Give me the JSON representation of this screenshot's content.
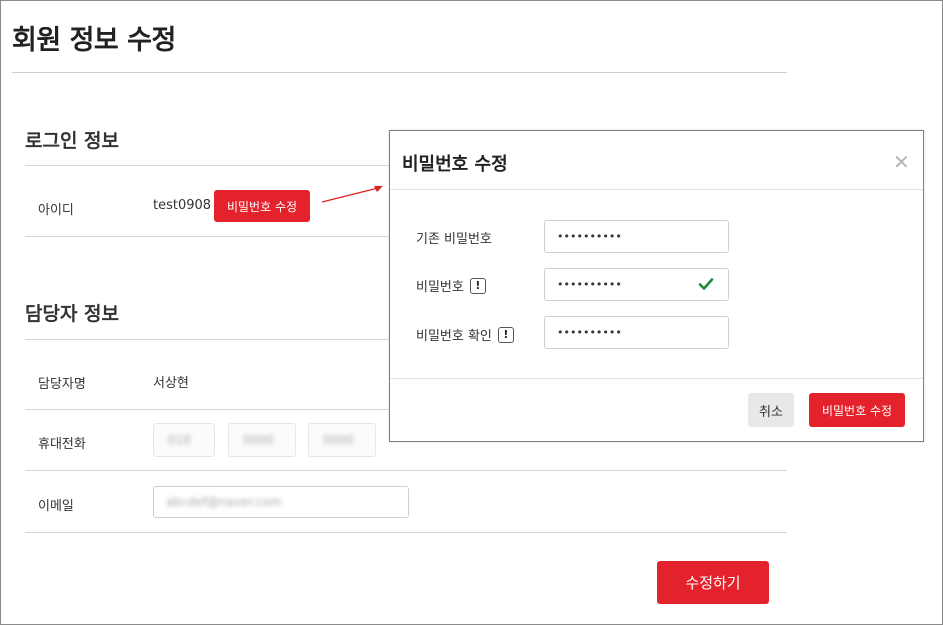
{
  "page": {
    "title": "회원 정보 수정"
  },
  "login_section": {
    "title": "로그인 정보",
    "id_label": "아이디",
    "id_value": "test0908",
    "change_password_button": "비밀번호 수정"
  },
  "manager_section": {
    "title": "담당자 정보",
    "name_label": "담당자명",
    "name_value": "서상현",
    "phone_label": "휴대전화",
    "phone_parts": [
      "010",
      "0000",
      "0000"
    ],
    "email_label": "이메일",
    "email_value": "abcdef@naver.com"
  },
  "submit_button": "수정하기",
  "modal": {
    "title": "비밀번호 수정",
    "close_glyph": "✕",
    "current_password_label": "기존 비밀번호",
    "current_password_value": "••••••••••",
    "new_password_label": "비밀번호",
    "new_password_value": "••••••••••",
    "confirm_password_label": "비밀번호 확인",
    "confirm_password_value": "••••••••••",
    "warn_glyph": "!",
    "cancel_button": "취소",
    "submit_button": "비밀번호 수정"
  },
  "colors": {
    "accent": "#e3222b",
    "check": "#1f8a3a"
  }
}
